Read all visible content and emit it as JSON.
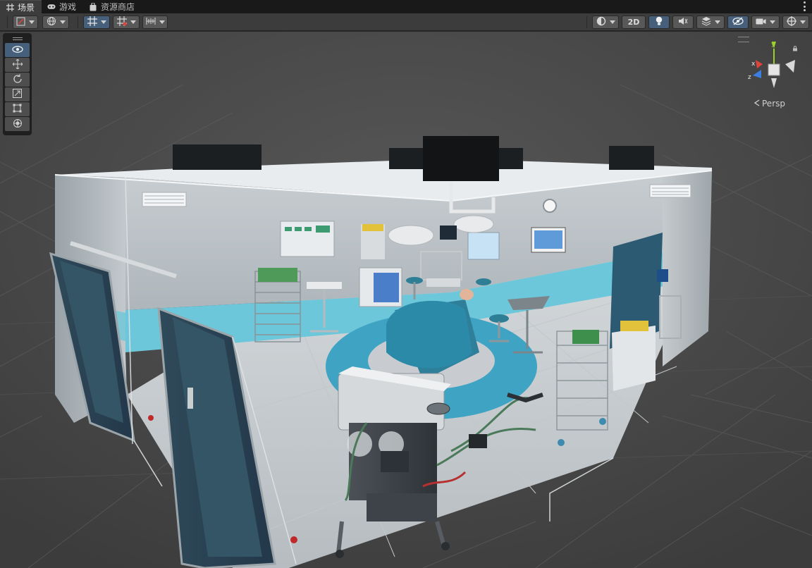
{
  "tabs": [
    {
      "label": "场景",
      "icon": "grid-icon",
      "active": true
    },
    {
      "label": "游戏",
      "icon": "gamepad-icon",
      "active": false
    },
    {
      "label": "资源商店",
      "icon": "shopping-bag-icon",
      "active": false
    }
  ],
  "toolbar": {
    "left_buttons": [
      "draw-mode-icon",
      "global-local-icon",
      "grid-snap-icon",
      "increment-snap-icon",
      "ruler-icon"
    ],
    "mode_2d_label": "2D",
    "right_buttons": [
      "shading-mode-icon",
      "lighting-icon",
      "audio-icon",
      "effects-icon",
      "hidden-objects-icon",
      "camera-icon",
      "gizmos-icon"
    ]
  },
  "tool_palette": [
    "view-tool-icon",
    "move-tool-icon",
    "rotate-tool-icon",
    "scale-tool-icon",
    "rect-tool-icon",
    "transform-tool-icon"
  ],
  "gizmo": {
    "axes": [
      "x",
      "y",
      "z"
    ],
    "projection_label": "Persp"
  },
  "colors": {
    "accent": "#46607c",
    "x_axis": "#e0433a",
    "y_axis": "#9ad22d",
    "z_axis": "#3c7ee0",
    "teal": "#3fa4c4"
  }
}
